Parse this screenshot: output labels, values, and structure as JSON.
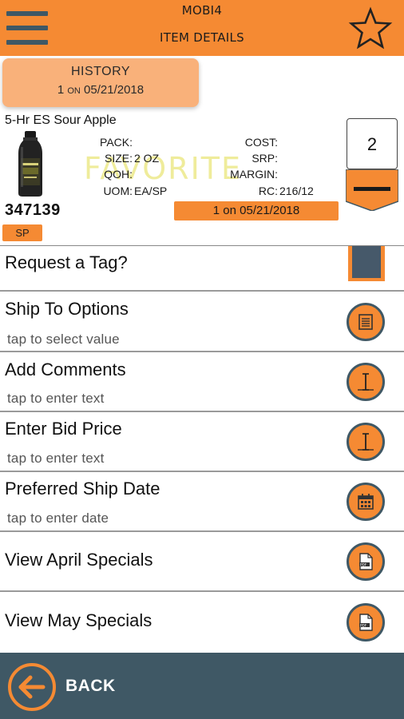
{
  "header": {
    "app_title": "MOBI4",
    "screen_title": "ITEM DETAILS"
  },
  "history": {
    "label": "HISTORY",
    "count": "1",
    "on_word": "ON",
    "date": "05/21/2018"
  },
  "item": {
    "name": "5-Hr ES Sour Apple",
    "number": "347139",
    "uom_badge": "SP",
    "watermark": "FAVORITE",
    "fields": {
      "pack_label": "PACK:",
      "pack_value": "",
      "size_label": "SIZE:",
      "size_value": "2 OZ",
      "qoh_label": "QOH:",
      "qoh_value": "",
      "uom_label": "UOM:",
      "uom_value": "EA/SP",
      "cost_label": "COST:",
      "cost_value": "",
      "srp_label": "SRP:",
      "srp_value": "",
      "margin_label": "MARGIN:",
      "margin_value": "",
      "rc_label": "RC:",
      "rc_value": "216/12"
    },
    "last_order": "1 on 05/21/2018"
  },
  "quantity": {
    "value": "2"
  },
  "options": [
    {
      "title": "Request a Tag?",
      "subtitle": "",
      "icon": "toggle-icon"
    },
    {
      "title": "Ship To Options",
      "subtitle": "tap to select value",
      "icon": "list-icon"
    },
    {
      "title": "Add Comments",
      "subtitle": "tap to enter text",
      "icon": "text-cursor-icon"
    },
    {
      "title": "Enter Bid Price",
      "subtitle": "tap to enter text",
      "icon": "text-cursor-icon"
    },
    {
      "title": "Preferred Ship Date",
      "subtitle": "tap to enter date",
      "icon": "calendar-icon"
    },
    {
      "title": "View April Specials",
      "subtitle": "",
      "icon": "pdf-icon"
    },
    {
      "title": "View May Specials",
      "subtitle": "",
      "icon": "pdf-icon"
    }
  ],
  "footer": {
    "back_label": "BACK"
  },
  "colors": {
    "accent": "#F58A33",
    "accent_light": "#F9B17A",
    "slate": "#3F5865",
    "watermark": "#EDE98A"
  }
}
